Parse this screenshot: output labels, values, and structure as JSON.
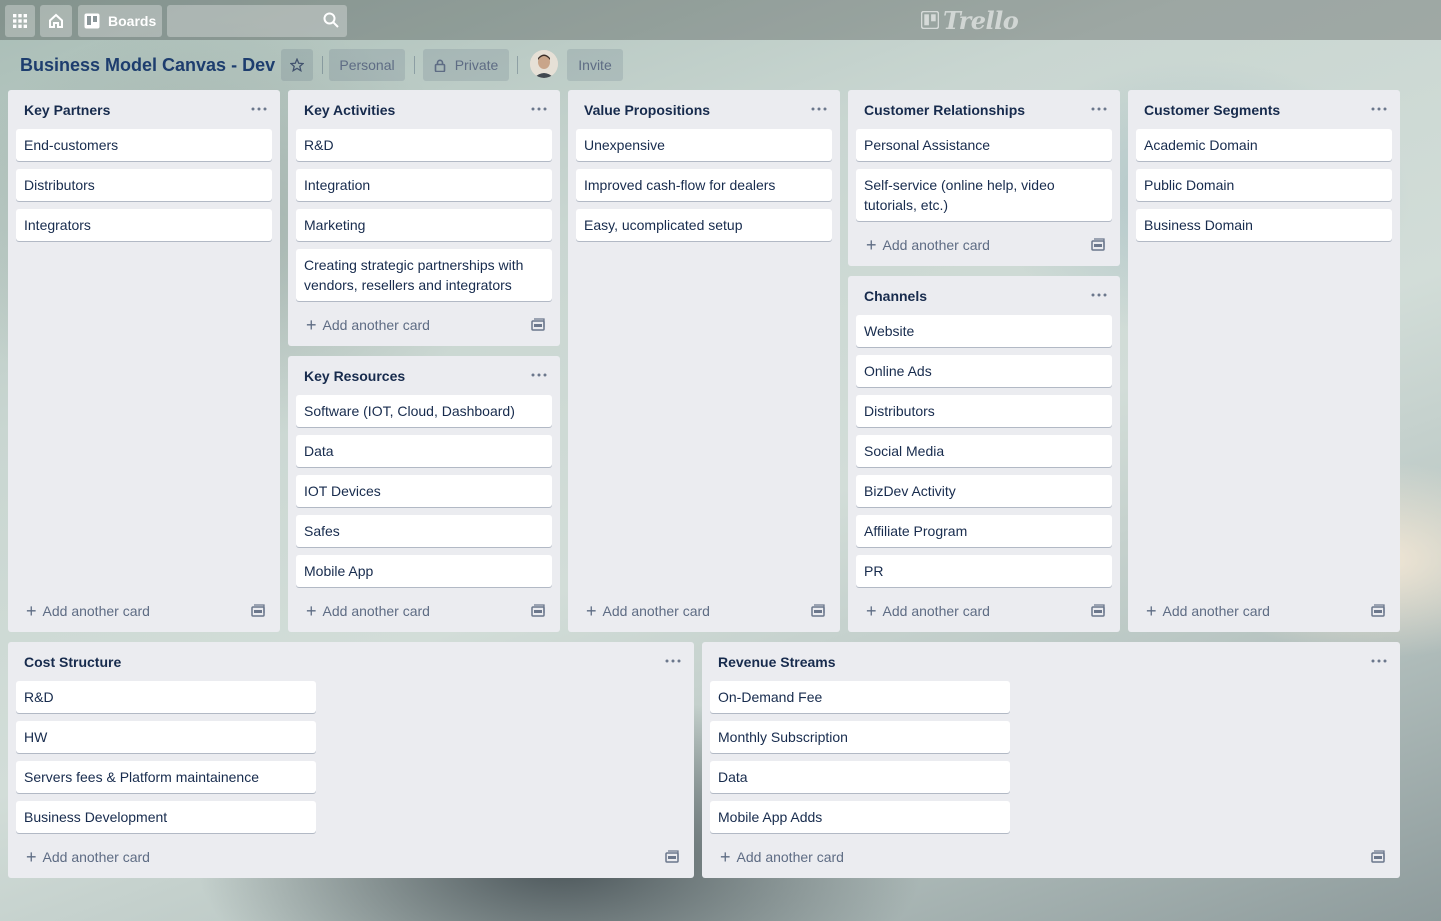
{
  "topbar": {
    "apps_icon": "grid-icon",
    "home_icon": "house-icon",
    "boards_label": "Boards",
    "search_value": "",
    "search_icon": "magnifier-icon",
    "logo_text": "Trello"
  },
  "board": {
    "title": "Business Model Canvas - Dev",
    "star_icon": "star-icon",
    "team_label": "Personal",
    "visibility_label": "Private",
    "invite_label": "Invite"
  },
  "add_card_label": "Add another card",
  "lists": {
    "key_partners": {
      "title": "Key Partners",
      "cards": [
        "End-customers",
        "Distributors",
        "Integrators"
      ]
    },
    "key_activities": {
      "title": "Key Activities",
      "cards": [
        "R&D",
        "Integration",
        "Marketing",
        "Creating strategic partnerships with vendors, resellers and integrators"
      ]
    },
    "key_resources": {
      "title": "Key Resources",
      "cards": [
        "Software (IOT, Cloud, Dashboard)",
        "Data",
        "IOT Devices",
        "Safes",
        "Mobile App"
      ]
    },
    "value_propositions": {
      "title": "Value Propositions",
      "cards": [
        "Unexpensive",
        "Improved cash-flow for dealers",
        "Easy, ucomplicated setup"
      ]
    },
    "customer_relationships": {
      "title": "Customer Relationships",
      "cards": [
        "Personal Assistance",
        "Self-service (online help, video tutorials, etc.)"
      ]
    },
    "channels": {
      "title": "Channels",
      "cards": [
        "Website",
        "Online Ads",
        "Distributors",
        "Social Media",
        "BizDev Activity",
        "Affiliate Program",
        "PR"
      ]
    },
    "customer_segments": {
      "title": "Customer Segments",
      "cards": [
        "Academic Domain",
        "Public Domain",
        "Business Domain"
      ]
    },
    "cost_structure": {
      "title": "Cost Structure",
      "cards": [
        "R&D",
        "HW",
        "Servers fees & Platform maintainence",
        "Business Development"
      ]
    },
    "revenue_streams": {
      "title": "Revenue Streams",
      "cards": [
        "On-Demand Fee",
        "Monthly Subscription",
        "Data",
        "Mobile App Adds"
      ]
    }
  }
}
